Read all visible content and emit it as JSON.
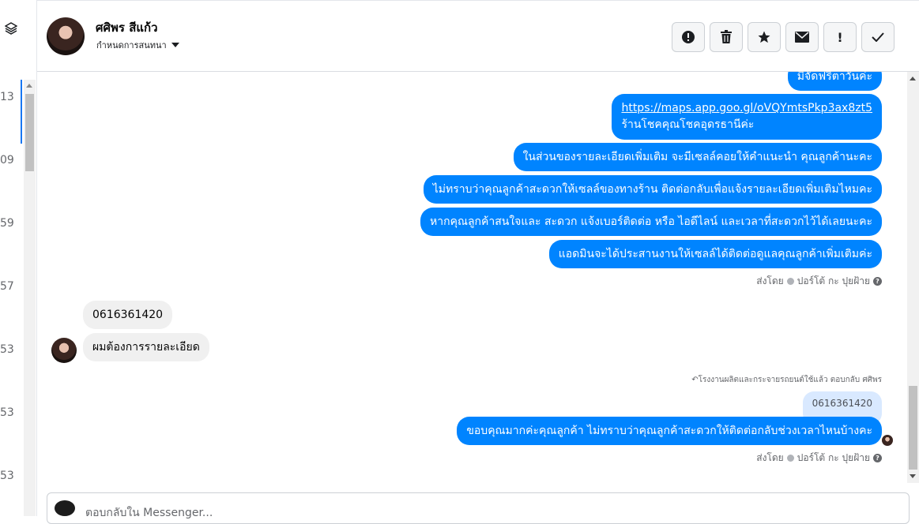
{
  "left_column": {
    "numbers": [
      "13",
      "09",
      "59",
      "57",
      "53",
      "53",
      "53"
    ]
  },
  "header": {
    "contact_name": "ศศิพร สีแก้ว",
    "assign_label": "กำหนดการสนทนา",
    "actions": [
      {
        "icon": "alert-circle-icon",
        "glyph": "!"
      },
      {
        "icon": "trash-icon",
        "glyph": ""
      },
      {
        "icon": "star-icon",
        "glyph": "★"
      },
      {
        "icon": "envelope-icon",
        "glyph": "✉"
      },
      {
        "icon": "exclamation-icon",
        "glyph": "!"
      },
      {
        "icon": "check-icon",
        "glyph": "✓"
      }
    ]
  },
  "messages": {
    "top_partial": "มีจัดฟรีตาวันค่ะ",
    "link_url": "https://maps.app.goo.gl/oVQYmtsPkp3ax8zt5",
    "link_caption": "ร้านโชคคุณโชคอุดรธานีค่ะ",
    "out_1": "ในส่วนของรายละเอียดเพิ่มเติม จะมีเซลล์คอยให้คำแนะนำ คุณลูกค้านะคะ",
    "out_2": "ไม่ทราบว่าคุณลูกค้าสะดวกให้เซลล์ของทางร้าน ติดต่อกลับเพื่อแจ้งรายละเอียดเพิ่มเติมไหมคะ",
    "out_3": "หากคุณลูกค้าสนใจและ สะดวก แจ้งเบอร์ติดต่อ หรือ ไอดีไลน์ และเวลาที่สะดวกไว้ได้เลยนะคะ",
    "out_4": "แอดมินจะได้ประสานงานให้เซลล์ได้ติดต่อดูแลคุณลูกค้าเพิ่มเติมค่ะ",
    "sent_by_1": "ส่งโดย",
    "sender_name_1": "ปอร์โต้ กะ ปุยฝ้าย",
    "in_1": "0616361420",
    "in_2": "ผมต้องการรายละเอียด",
    "replied_note": "โรงงานผลิตและกระจายรถยนต์ใช้แล้ว ตอบกลับ ศศิพร",
    "quoted": "0616361420",
    "out_5": "ขอบคุณมากค่ะคุณลูกค้า ไม่ทราบว่าคุณลูกค้าสะดวกให้ติดต่อกลับช่วงเวลาไหนบ้างคะ",
    "sent_by_2": "ส่งโดย",
    "sender_name_2": "ปอร์โต้ กะ ปุยฝ้าย"
  },
  "composer": {
    "placeholder": "ตอบกลับใน Messenger..."
  },
  "colors": {
    "outgoing_bubble": "#0084ff",
    "incoming_bubble": "#f0f0f0",
    "quoted_bubble": "#d9e9ff"
  }
}
